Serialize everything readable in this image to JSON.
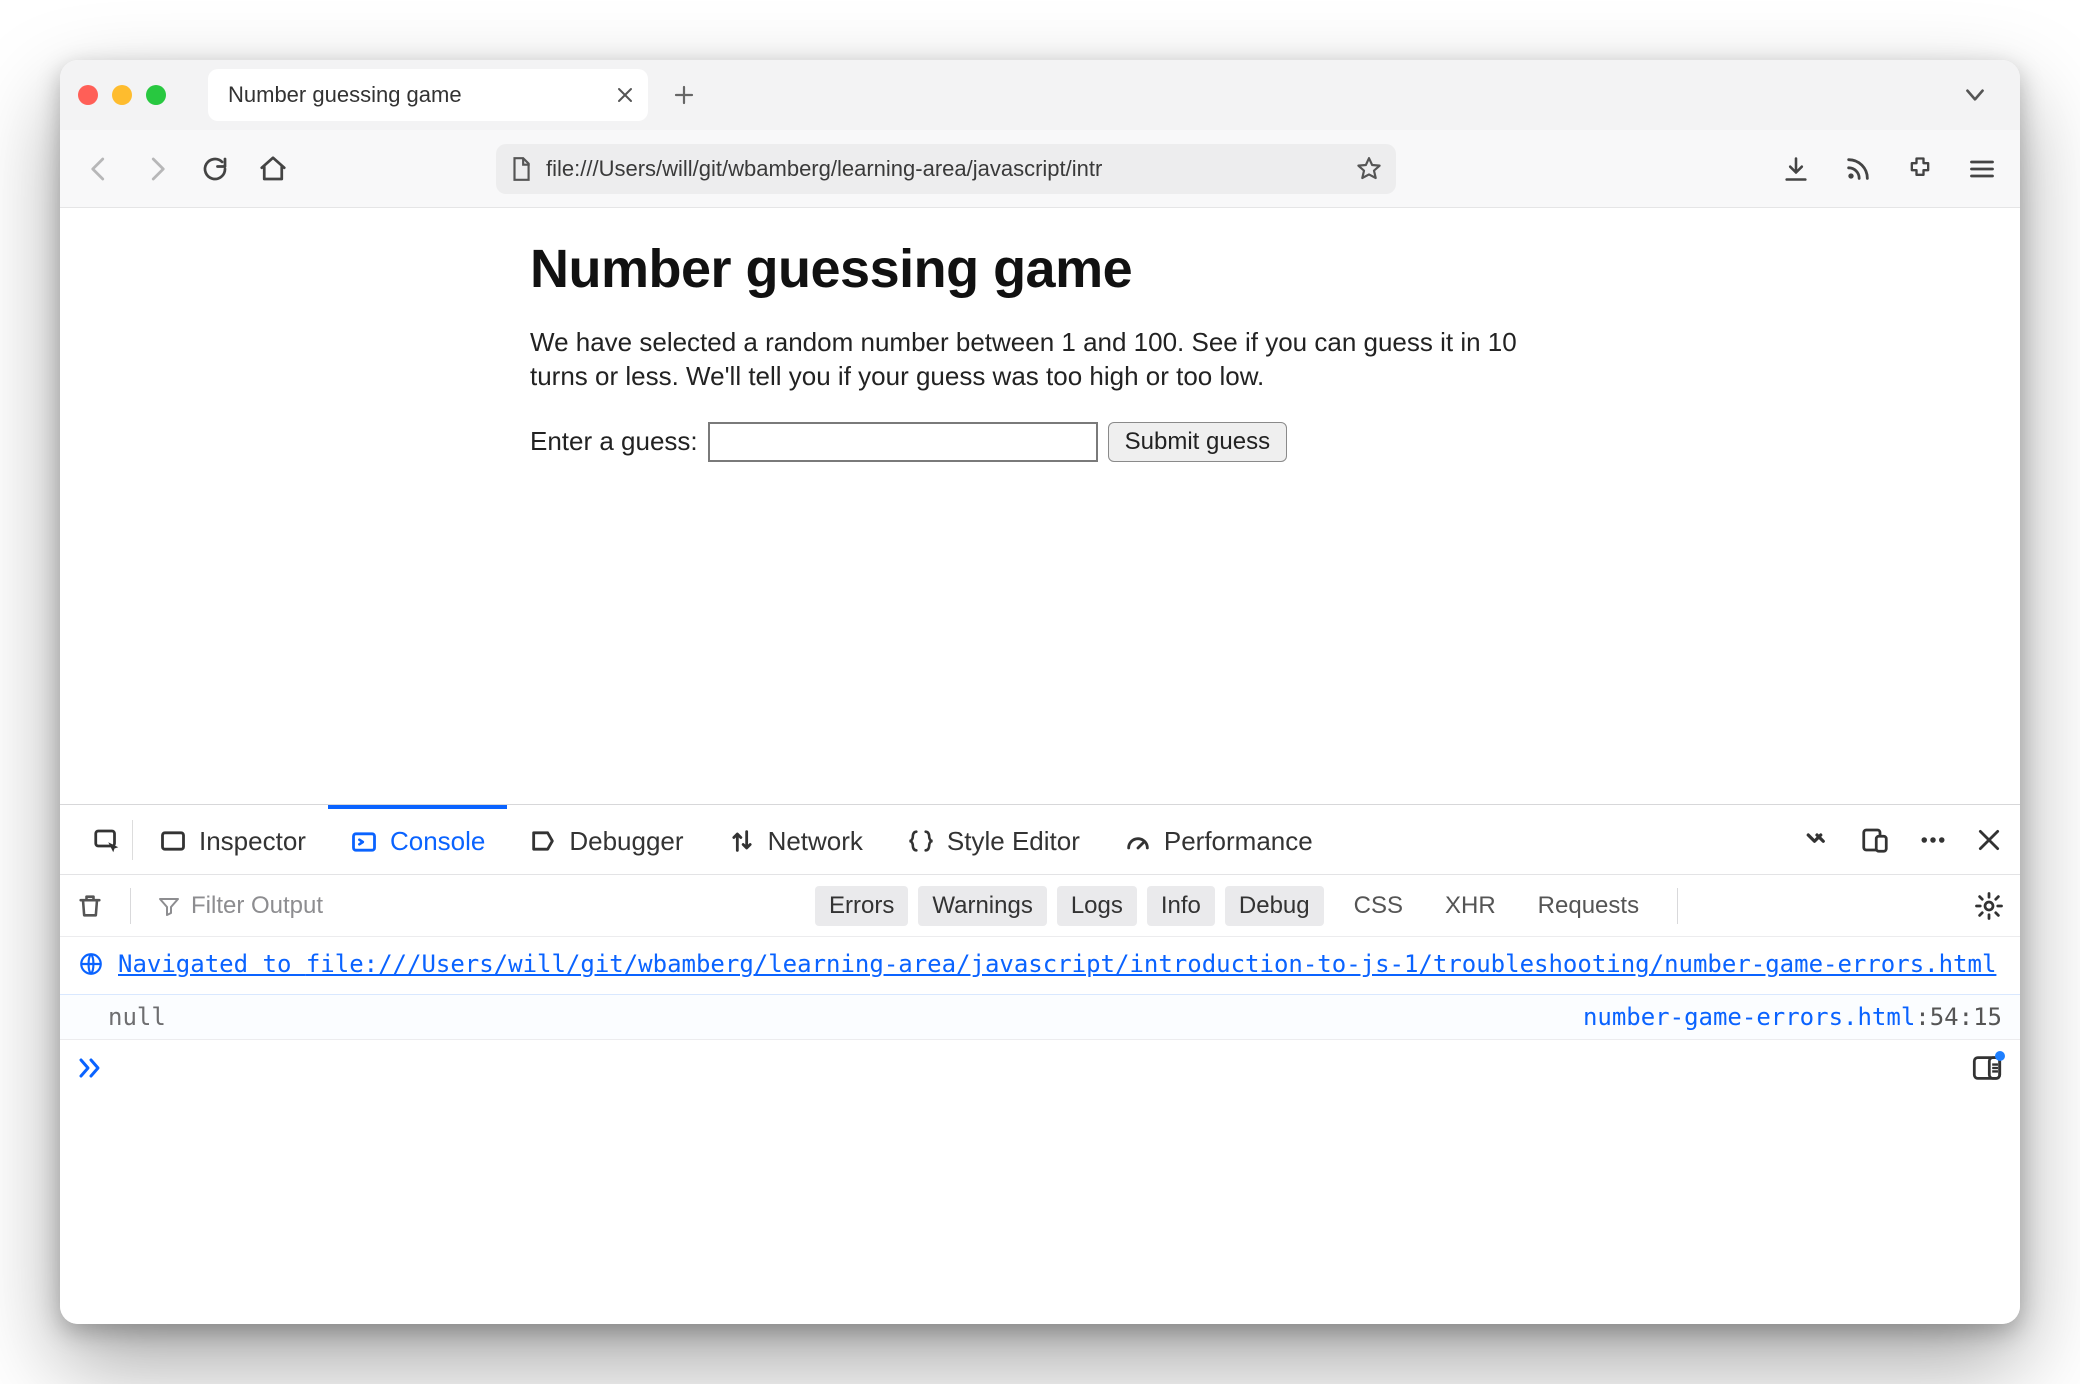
{
  "browser": {
    "tab_title": "Number guessing game",
    "url": "file:///Users/will/git/wbamberg/learning-area/javascript/intr"
  },
  "page": {
    "heading": "Number guessing game",
    "description": "We have selected a random number between 1 and 100. See if you can guess it in 10 turns or less. We'll tell you if your guess was too high or too low.",
    "guess_label": "Enter a guess:",
    "guess_value": "",
    "submit_label": "Submit guess"
  },
  "devtools": {
    "tabs": {
      "inspector": "Inspector",
      "console": "Console",
      "debugger": "Debugger",
      "network": "Network",
      "style_editor": "Style Editor",
      "performance": "Performance"
    },
    "active_tab": "console",
    "filter_placeholder": "Filter Output",
    "categories": {
      "errors": "Errors",
      "warnings": "Warnings",
      "logs": "Logs",
      "info": "Info",
      "debug": "Debug"
    },
    "extra": {
      "css": "CSS",
      "xhr": "XHR",
      "requests": "Requests"
    },
    "nav_prefix": "Navigated to ",
    "nav_url": "file:///Users/will/git/wbamberg/learning-area/javascript/introduction-to-js-1/troubleshooting/number-game-errors.html",
    "log_value": "null",
    "log_source_file": "number-game-errors.html",
    "log_source_line": "54",
    "log_source_col": "15"
  }
}
